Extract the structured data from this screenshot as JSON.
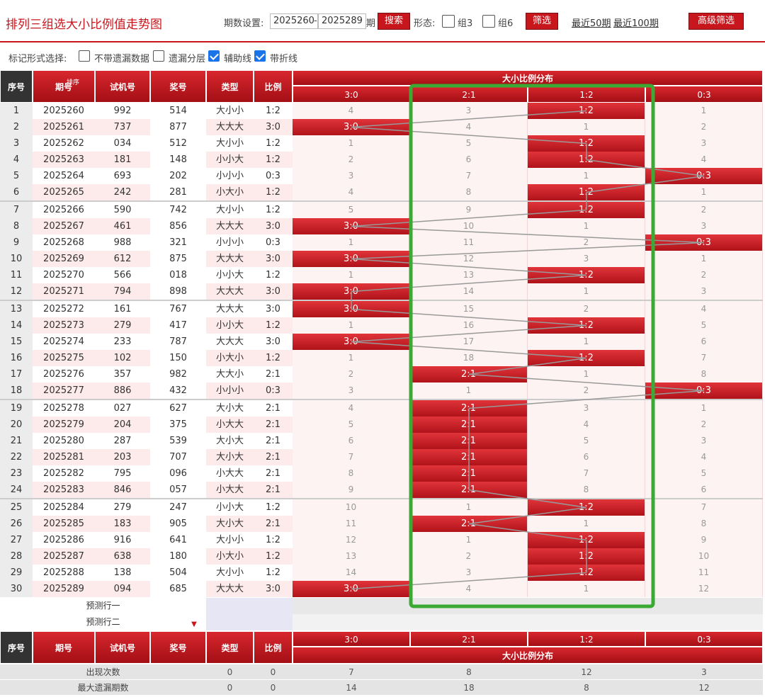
{
  "header": {
    "title": "排列三组选大小比例值走势图",
    "period_label": "期数设置:",
    "period_start": "2025260",
    "period_end": "2025289",
    "period_unit": "期",
    "search_label": "搜索",
    "form_label": "形态:",
    "form_zu3": "组3",
    "form_zu6": "组6",
    "filter_label": "筛选",
    "recent50": "最近50期",
    "recent100": "最近100期",
    "advanced_label": "高级筛选"
  },
  "options": {
    "label": "标记形式选择:",
    "items": [
      {
        "label": "不带遗漏数据",
        "checked": false
      },
      {
        "label": "遗漏分层",
        "checked": false
      },
      {
        "label": "辅助线",
        "checked": true
      },
      {
        "label": "带折线",
        "checked": true
      }
    ]
  },
  "table": {
    "headers": {
      "seq": "序号",
      "issue": "期号",
      "sort": "排序",
      "test": "试机号",
      "prize": "奖号",
      "type": "类型",
      "ratio": "比例",
      "dist": "大小比例分布"
    },
    "dist_cols": [
      "3:0",
      "2:1",
      "1:2",
      "0:3"
    ],
    "rows": [
      {
        "seq": "1",
        "issue": "2025260",
        "test": "992",
        "prize": "514",
        "type": "大小小",
        "ratio": "1:2",
        "cells": [
          "4",
          "3",
          "1:2",
          "1"
        ]
      },
      {
        "seq": "2",
        "issue": "2025261",
        "test": "737",
        "prize": "877",
        "type": "大大大",
        "ratio": "3:0",
        "cells": [
          "3:0",
          "4",
          "1",
          "2"
        ]
      },
      {
        "seq": "3",
        "issue": "2025262",
        "test": "034",
        "prize": "512",
        "type": "大小小",
        "ratio": "1:2",
        "cells": [
          "1",
          "5",
          "1:2",
          "3"
        ]
      },
      {
        "seq": "4",
        "issue": "2025263",
        "test": "181",
        "prize": "148",
        "type": "小小大",
        "ratio": "1:2",
        "cells": [
          "2",
          "6",
          "1:2",
          "4"
        ]
      },
      {
        "seq": "5",
        "issue": "2025264",
        "test": "693",
        "prize": "202",
        "type": "小小小",
        "ratio": "0:3",
        "cells": [
          "3",
          "7",
          "1",
          "0:3"
        ]
      },
      {
        "seq": "6",
        "issue": "2025265",
        "test": "242",
        "prize": "281",
        "type": "小大小",
        "ratio": "1:2",
        "cells": [
          "4",
          "8",
          "1:2",
          "1"
        ]
      },
      {
        "seq": "7",
        "issue": "2025266",
        "test": "590",
        "prize": "742",
        "type": "大小小",
        "ratio": "1:2",
        "cells": [
          "5",
          "9",
          "1:2",
          "2"
        ]
      },
      {
        "seq": "8",
        "issue": "2025267",
        "test": "461",
        "prize": "856",
        "type": "大大大",
        "ratio": "3:0",
        "cells": [
          "3:0",
          "10",
          "1",
          "3"
        ]
      },
      {
        "seq": "9",
        "issue": "2025268",
        "test": "988",
        "prize": "321",
        "type": "小小小",
        "ratio": "0:3",
        "cells": [
          "1",
          "11",
          "2",
          "0:3"
        ]
      },
      {
        "seq": "10",
        "issue": "2025269",
        "test": "612",
        "prize": "875",
        "type": "大大大",
        "ratio": "3:0",
        "cells": [
          "3:0",
          "12",
          "3",
          "1"
        ]
      },
      {
        "seq": "11",
        "issue": "2025270",
        "test": "566",
        "prize": "018",
        "type": "小小大",
        "ratio": "1:2",
        "cells": [
          "1",
          "13",
          "1:2",
          "2"
        ]
      },
      {
        "seq": "12",
        "issue": "2025271",
        "test": "794",
        "prize": "898",
        "type": "大大大",
        "ratio": "3:0",
        "cells": [
          "3:0",
          "14",
          "1",
          "3"
        ]
      },
      {
        "seq": "13",
        "issue": "2025272",
        "test": "161",
        "prize": "767",
        "type": "大大大",
        "ratio": "3:0",
        "cells": [
          "3:0",
          "15",
          "2",
          "4"
        ]
      },
      {
        "seq": "14",
        "issue": "2025273",
        "test": "279",
        "prize": "417",
        "type": "小小大",
        "ratio": "1:2",
        "cells": [
          "1",
          "16",
          "1:2",
          "5"
        ]
      },
      {
        "seq": "15",
        "issue": "2025274",
        "test": "233",
        "prize": "787",
        "type": "大大大",
        "ratio": "3:0",
        "cells": [
          "3:0",
          "17",
          "1",
          "6"
        ]
      },
      {
        "seq": "16",
        "issue": "2025275",
        "test": "102",
        "prize": "150",
        "type": "小大小",
        "ratio": "1:2",
        "cells": [
          "1",
          "18",
          "1:2",
          "7"
        ]
      },
      {
        "seq": "17",
        "issue": "2025276",
        "test": "357",
        "prize": "982",
        "type": "大大小",
        "ratio": "2:1",
        "cells": [
          "2",
          "2:1",
          "1",
          "8"
        ]
      },
      {
        "seq": "18",
        "issue": "2025277",
        "test": "886",
        "prize": "432",
        "type": "小小小",
        "ratio": "0:3",
        "cells": [
          "3",
          "1",
          "2",
          "0:3"
        ]
      },
      {
        "seq": "19",
        "issue": "2025278",
        "test": "027",
        "prize": "627",
        "type": "大小大",
        "ratio": "2:1",
        "cells": [
          "4",
          "2:1",
          "3",
          "1"
        ]
      },
      {
        "seq": "20",
        "issue": "2025279",
        "test": "204",
        "prize": "375",
        "type": "小大大",
        "ratio": "2:1",
        "cells": [
          "5",
          "2:1",
          "4",
          "2"
        ]
      },
      {
        "seq": "21",
        "issue": "2025280",
        "test": "287",
        "prize": "539",
        "type": "大小大",
        "ratio": "2:1",
        "cells": [
          "6",
          "2:1",
          "5",
          "3"
        ]
      },
      {
        "seq": "22",
        "issue": "2025281",
        "test": "203",
        "prize": "707",
        "type": "大小大",
        "ratio": "2:1",
        "cells": [
          "7",
          "2:1",
          "6",
          "4"
        ]
      },
      {
        "seq": "23",
        "issue": "2025282",
        "test": "795",
        "prize": "096",
        "type": "小大大",
        "ratio": "2:1",
        "cells": [
          "8",
          "2:1",
          "7",
          "5"
        ]
      },
      {
        "seq": "24",
        "issue": "2025283",
        "test": "846",
        "prize": "057",
        "type": "小大大",
        "ratio": "2:1",
        "cells": [
          "9",
          "2:1",
          "8",
          "6"
        ]
      },
      {
        "seq": "25",
        "issue": "2025284",
        "test": "279",
        "prize": "247",
        "type": "小小大",
        "ratio": "1:2",
        "cells": [
          "10",
          "1",
          "1:2",
          "7"
        ]
      },
      {
        "seq": "26",
        "issue": "2025285",
        "test": "183",
        "prize": "905",
        "type": "大小大",
        "ratio": "2:1",
        "cells": [
          "11",
          "2:1",
          "1",
          "8"
        ]
      },
      {
        "seq": "27",
        "issue": "2025286",
        "test": "916",
        "prize": "641",
        "type": "大小小",
        "ratio": "1:2",
        "cells": [
          "12",
          "1",
          "1:2",
          "9"
        ]
      },
      {
        "seq": "28",
        "issue": "2025287",
        "test": "638",
        "prize": "180",
        "type": "小大小",
        "ratio": "1:2",
        "cells": [
          "13",
          "2",
          "1:2",
          "10"
        ]
      },
      {
        "seq": "29",
        "issue": "2025288",
        "test": "138",
        "prize": "504",
        "type": "大小小",
        "ratio": "1:2",
        "cells": [
          "14",
          "3",
          "1:2",
          "11"
        ]
      },
      {
        "seq": "30",
        "issue": "2025289",
        "test": "094",
        "prize": "685",
        "type": "大大大",
        "ratio": "3:0",
        "cells": [
          "3:0",
          "4",
          "1",
          "12"
        ]
      }
    ],
    "predict1": "预测行一",
    "predict2": "预测行二",
    "summary": [
      {
        "label": "出现次数",
        "type": "0",
        "ratio": "0",
        "dist": [
          "7",
          "8",
          "12",
          "3"
        ]
      },
      {
        "label": "最大遗漏期数",
        "type": "0",
        "ratio": "0",
        "dist": [
          "14",
          "18",
          "8",
          "12"
        ]
      }
    ]
  },
  "colors": {
    "accent": "#c8161d",
    "highlight_box": "#3aaa35",
    "trend_line": "#999999"
  }
}
